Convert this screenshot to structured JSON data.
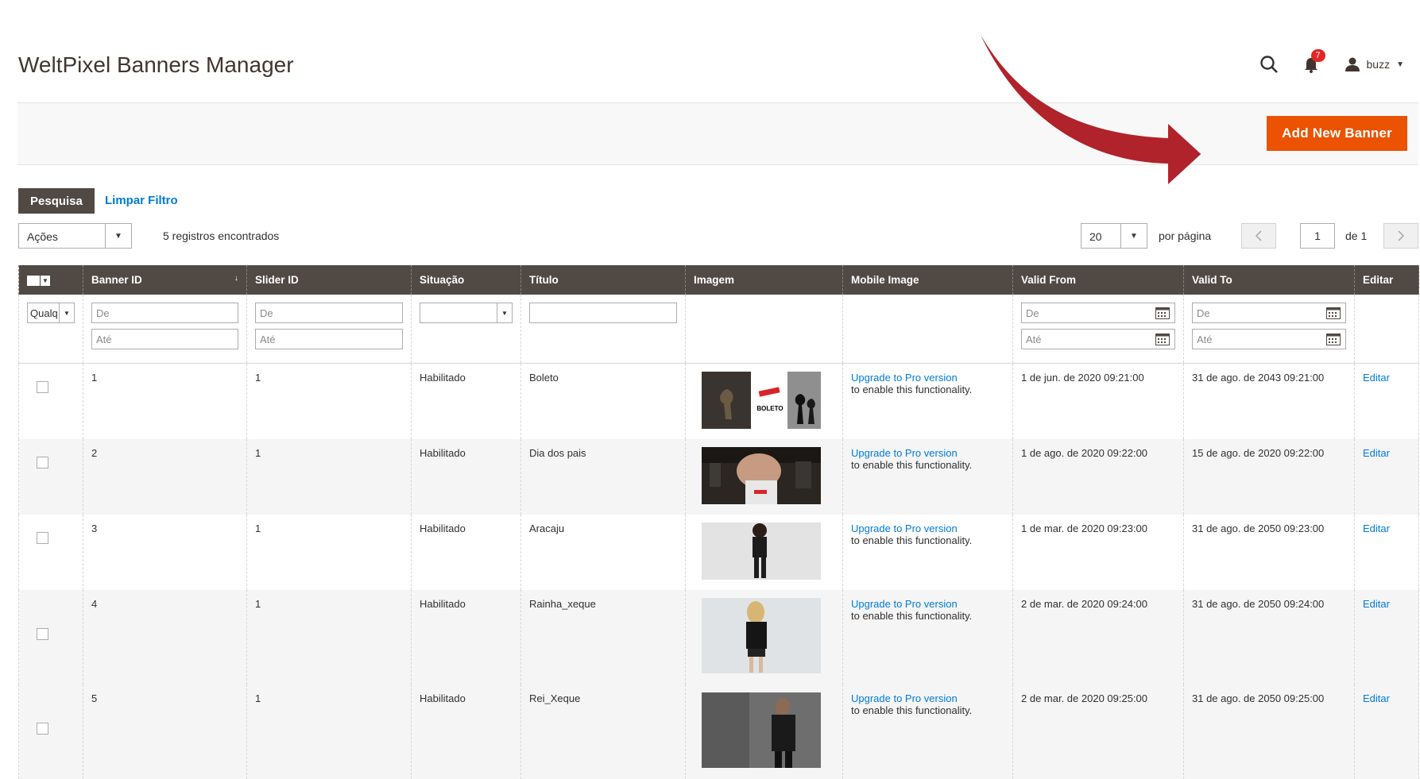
{
  "header": {
    "title": "WeltPixel Banners Manager",
    "notification_count": "7",
    "user_name": "buzz"
  },
  "toolbar": {
    "add_new_label": "Add New Banner"
  },
  "grid_controls": {
    "search_label": "Pesquisa",
    "clear_filter_label": "Limpar Filtro",
    "actions_label": "Ações",
    "records_found": "5 registros encontrados",
    "per_page_value": "20",
    "per_page_label": "por página",
    "current_page": "1",
    "total_pages_label": "de 1"
  },
  "columns": [
    "Banner ID",
    "Slider ID",
    "Situação",
    "Título",
    "Imagem",
    "Mobile Image",
    "Valid From",
    "Valid To",
    "Editar"
  ],
  "filters": {
    "massaction_value": "Qualq",
    "from_placeholder": "De",
    "to_placeholder": "Até"
  },
  "rows": [
    {
      "banner_id": "1",
      "slider_id": "1",
      "status": "Habilitado",
      "title": "Boleto",
      "image": "chess-boleto-image",
      "mobile_link": "Upgrade to Pro version",
      "mobile_text": "to enable this functionality.",
      "valid_from": "1 de jun. de 2020 09:21:00",
      "valid_to": "31 de ago. de 2043 09:21:00",
      "edit": "Editar"
    },
    {
      "banner_id": "2",
      "slider_id": "1",
      "status": "Habilitado",
      "title": "Dia dos pais",
      "image": "father-son-image",
      "mobile_link": "Upgrade to Pro version",
      "mobile_text": "to enable this functionality.",
      "valid_from": "1 de ago. de 2020 09:22:00",
      "valid_to": "15 de ago. de 2020 09:22:00",
      "edit": "Editar"
    },
    {
      "banner_id": "3",
      "slider_id": "1",
      "status": "Habilitado",
      "title": "Aracaju",
      "image": "woman-standing-image",
      "mobile_link": "Upgrade to Pro version",
      "mobile_text": "to enable this functionality.",
      "valid_from": "1 de mar. de 2020 09:23:00",
      "valid_to": "31 de ago. de 2050 09:23:00",
      "edit": "Editar"
    },
    {
      "banner_id": "4",
      "slider_id": "1",
      "status": "Habilitado",
      "title": "Rainha_xeque",
      "image": "blonde-woman-image",
      "mobile_link": "Upgrade to Pro version",
      "mobile_text": "to enable this functionality.",
      "valid_from": "2 de mar. de 2020 09:24:00",
      "valid_to": "31 de ago. de 2050 09:24:00",
      "edit": "Editar"
    },
    {
      "banner_id": "5",
      "slider_id": "1",
      "status": "Habilitado",
      "title": "Rei_Xeque",
      "image": "man-dark-image",
      "mobile_link": "Upgrade to Pro version",
      "mobile_text": "to enable this functionality.",
      "valid_from": "2 de mar. de 2020 09:25:00",
      "valid_to": "31 de ago. de 2050 09:25:00",
      "edit": "Editar"
    }
  ],
  "colors": {
    "accent": "#eb5202",
    "header_bg": "#514943",
    "link": "#007bdb",
    "arrow": "#b0232a"
  }
}
